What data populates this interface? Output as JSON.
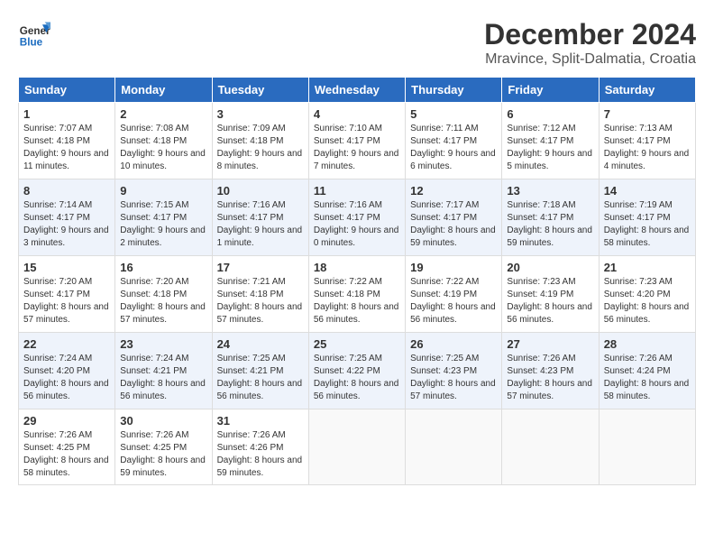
{
  "header": {
    "logo_general": "General",
    "logo_blue": "Blue",
    "month": "December 2024",
    "location": "Mravince, Split-Dalmatia, Croatia"
  },
  "weekdays": [
    "Sunday",
    "Monday",
    "Tuesday",
    "Wednesday",
    "Thursday",
    "Friday",
    "Saturday"
  ],
  "weeks": [
    [
      {
        "day": "1",
        "sunrise": "Sunrise: 7:07 AM",
        "sunset": "Sunset: 4:18 PM",
        "daylight": "Daylight: 9 hours and 11 minutes."
      },
      {
        "day": "2",
        "sunrise": "Sunrise: 7:08 AM",
        "sunset": "Sunset: 4:18 PM",
        "daylight": "Daylight: 9 hours and 10 minutes."
      },
      {
        "day": "3",
        "sunrise": "Sunrise: 7:09 AM",
        "sunset": "Sunset: 4:18 PM",
        "daylight": "Daylight: 9 hours and 8 minutes."
      },
      {
        "day": "4",
        "sunrise": "Sunrise: 7:10 AM",
        "sunset": "Sunset: 4:17 PM",
        "daylight": "Daylight: 9 hours and 7 minutes."
      },
      {
        "day": "5",
        "sunrise": "Sunrise: 7:11 AM",
        "sunset": "Sunset: 4:17 PM",
        "daylight": "Daylight: 9 hours and 6 minutes."
      },
      {
        "day": "6",
        "sunrise": "Sunrise: 7:12 AM",
        "sunset": "Sunset: 4:17 PM",
        "daylight": "Daylight: 9 hours and 5 minutes."
      },
      {
        "day": "7",
        "sunrise": "Sunrise: 7:13 AM",
        "sunset": "Sunset: 4:17 PM",
        "daylight": "Daylight: 9 hours and 4 minutes."
      }
    ],
    [
      {
        "day": "8",
        "sunrise": "Sunrise: 7:14 AM",
        "sunset": "Sunset: 4:17 PM",
        "daylight": "Daylight: 9 hours and 3 minutes."
      },
      {
        "day": "9",
        "sunrise": "Sunrise: 7:15 AM",
        "sunset": "Sunset: 4:17 PM",
        "daylight": "Daylight: 9 hours and 2 minutes."
      },
      {
        "day": "10",
        "sunrise": "Sunrise: 7:16 AM",
        "sunset": "Sunset: 4:17 PM",
        "daylight": "Daylight: 9 hours and 1 minute."
      },
      {
        "day": "11",
        "sunrise": "Sunrise: 7:16 AM",
        "sunset": "Sunset: 4:17 PM",
        "daylight": "Daylight: 9 hours and 0 minutes."
      },
      {
        "day": "12",
        "sunrise": "Sunrise: 7:17 AM",
        "sunset": "Sunset: 4:17 PM",
        "daylight": "Daylight: 8 hours and 59 minutes."
      },
      {
        "day": "13",
        "sunrise": "Sunrise: 7:18 AM",
        "sunset": "Sunset: 4:17 PM",
        "daylight": "Daylight: 8 hours and 59 minutes."
      },
      {
        "day": "14",
        "sunrise": "Sunrise: 7:19 AM",
        "sunset": "Sunset: 4:17 PM",
        "daylight": "Daylight: 8 hours and 58 minutes."
      }
    ],
    [
      {
        "day": "15",
        "sunrise": "Sunrise: 7:20 AM",
        "sunset": "Sunset: 4:17 PM",
        "daylight": "Daylight: 8 hours and 57 minutes."
      },
      {
        "day": "16",
        "sunrise": "Sunrise: 7:20 AM",
        "sunset": "Sunset: 4:18 PM",
        "daylight": "Daylight: 8 hours and 57 minutes."
      },
      {
        "day": "17",
        "sunrise": "Sunrise: 7:21 AM",
        "sunset": "Sunset: 4:18 PM",
        "daylight": "Daylight: 8 hours and 57 minutes."
      },
      {
        "day": "18",
        "sunrise": "Sunrise: 7:22 AM",
        "sunset": "Sunset: 4:18 PM",
        "daylight": "Daylight: 8 hours and 56 minutes."
      },
      {
        "day": "19",
        "sunrise": "Sunrise: 7:22 AM",
        "sunset": "Sunset: 4:19 PM",
        "daylight": "Daylight: 8 hours and 56 minutes."
      },
      {
        "day": "20",
        "sunrise": "Sunrise: 7:23 AM",
        "sunset": "Sunset: 4:19 PM",
        "daylight": "Daylight: 8 hours and 56 minutes."
      },
      {
        "day": "21",
        "sunrise": "Sunrise: 7:23 AM",
        "sunset": "Sunset: 4:20 PM",
        "daylight": "Daylight: 8 hours and 56 minutes."
      }
    ],
    [
      {
        "day": "22",
        "sunrise": "Sunrise: 7:24 AM",
        "sunset": "Sunset: 4:20 PM",
        "daylight": "Daylight: 8 hours and 56 minutes."
      },
      {
        "day": "23",
        "sunrise": "Sunrise: 7:24 AM",
        "sunset": "Sunset: 4:21 PM",
        "daylight": "Daylight: 8 hours and 56 minutes."
      },
      {
        "day": "24",
        "sunrise": "Sunrise: 7:25 AM",
        "sunset": "Sunset: 4:21 PM",
        "daylight": "Daylight: 8 hours and 56 minutes."
      },
      {
        "day": "25",
        "sunrise": "Sunrise: 7:25 AM",
        "sunset": "Sunset: 4:22 PM",
        "daylight": "Daylight: 8 hours and 56 minutes."
      },
      {
        "day": "26",
        "sunrise": "Sunrise: 7:25 AM",
        "sunset": "Sunset: 4:23 PM",
        "daylight": "Daylight: 8 hours and 57 minutes."
      },
      {
        "day": "27",
        "sunrise": "Sunrise: 7:26 AM",
        "sunset": "Sunset: 4:23 PM",
        "daylight": "Daylight: 8 hours and 57 minutes."
      },
      {
        "day": "28",
        "sunrise": "Sunrise: 7:26 AM",
        "sunset": "Sunset: 4:24 PM",
        "daylight": "Daylight: 8 hours and 58 minutes."
      }
    ],
    [
      {
        "day": "29",
        "sunrise": "Sunrise: 7:26 AM",
        "sunset": "Sunset: 4:25 PM",
        "daylight": "Daylight: 8 hours and 58 minutes."
      },
      {
        "day": "30",
        "sunrise": "Sunrise: 7:26 AM",
        "sunset": "Sunset: 4:25 PM",
        "daylight": "Daylight: 8 hours and 59 minutes."
      },
      {
        "day": "31",
        "sunrise": "Sunrise: 7:26 AM",
        "sunset": "Sunset: 4:26 PM",
        "daylight": "Daylight: 8 hours and 59 minutes."
      },
      null,
      null,
      null,
      null
    ]
  ]
}
